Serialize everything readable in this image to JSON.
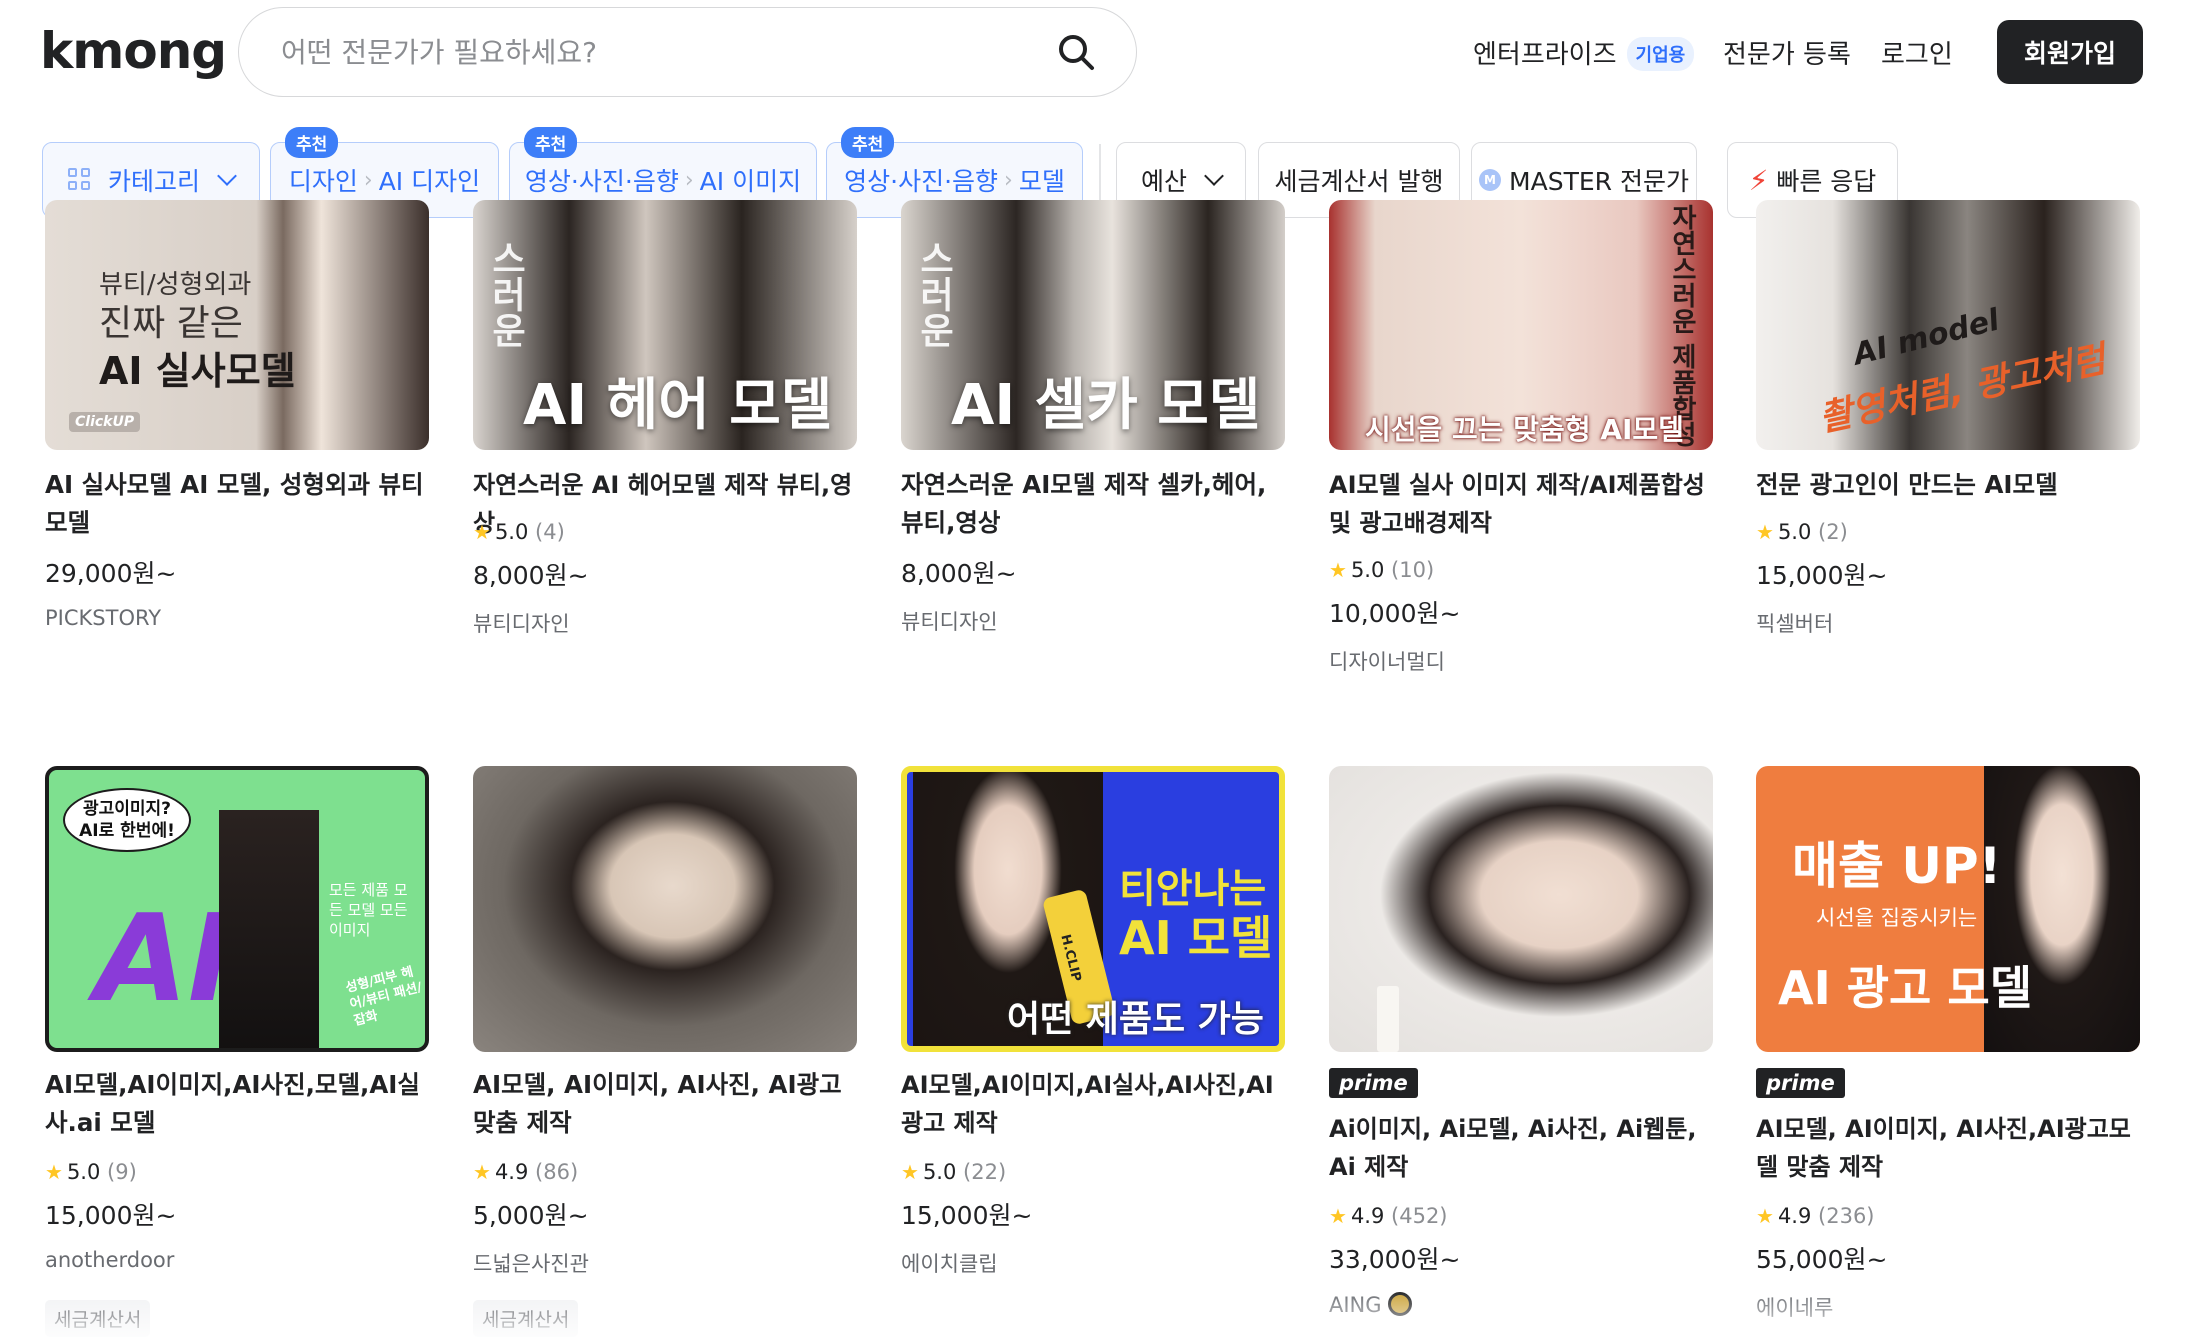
{
  "header": {
    "logo": "kmong",
    "search_placeholder": "어떤 전문가가 필요하세요?",
    "nav": {
      "enterprise": "엔터프라이즈",
      "enterprise_badge": "기업용",
      "register": "전문가 등록",
      "login": "로그인",
      "signup": "회원가입"
    }
  },
  "filters": {
    "category": "카테고리",
    "rec_label": "추천",
    "rec1": {
      "a": "디자인",
      "b": "AI 디자인"
    },
    "rec2": {
      "a": "영상·사진·음향",
      "b": "AI 이미지"
    },
    "rec3": {
      "a": "영상·사진·음향",
      "b": "모델"
    },
    "budget": "예산",
    "tax": "세금계산서 발행",
    "master": "MASTER 전문가",
    "fast": "빠른 응답"
  },
  "row1": [
    {
      "title": "AI 실사모델 AI 모델, 성형외과 뷰티 모델",
      "price": "29,000원~",
      "seller": "PICKSTORY",
      "overlay1": "뷰티/성형외과",
      "overlay2": "진짜 같은",
      "overlay3": "AI 실사모델",
      "watermark": "ClickUP"
    },
    {
      "title": "자연스러운 AI 헤어모델 제작 뷰티,영상",
      "rating": "5.0",
      "count": "(4)",
      "price": "8,000원~",
      "seller": "뷰티디자인",
      "overlay1": "AI 헤어 모델",
      "side": "스러운"
    },
    {
      "title": "자연스러운 AI모델 제작 셀카,헤어,뷰티,영상",
      "price": "8,000원~",
      "seller": "뷰티디자인",
      "overlay1": "AI 셀카 모델",
      "side": "스러운"
    },
    {
      "title": "AI모델 실사 이미지 제작/AI제품합성 및 광고배경제작",
      "rating": "5.0",
      "count": "(10)",
      "price": "10,000원~",
      "seller": "디자이너멀디",
      "overlay1": "시선을 끄는 맞춤형 AI모델",
      "side": "자연스러운 제품합성"
    },
    {
      "title": "전문 광고인이 만드는 AI모델",
      "rating": "5.0",
      "count": "(2)",
      "price": "15,000원~",
      "seller": "픽셀버터",
      "overlay1": "AI model",
      "overlay2": "촬영처럼, 광고처럼"
    }
  ],
  "row2": [
    {
      "title": "AI모델,AI이미지,AI사진,모델,AI실사.ai 모델",
      "rating": "5.0",
      "count": "(9)",
      "price": "15,000원~",
      "seller": "anotherdoor",
      "tag": "세금계산서",
      "bubble": "광고이미지? AI로 한번에!",
      "big": "AI",
      "side": "모든 제품 모든 모델 모든 이미지",
      "small": "성형/피부 헤어/뷰티 패션/잡화"
    },
    {
      "title": "AI모델, AI이미지, AI사진, AI광고 맞춤 제작",
      "rating": "4.9",
      "count": "(86)",
      "price": "5,000원~",
      "seller": "드넓은사진관",
      "tag": "세금계산서"
    },
    {
      "title": "AI모델,AI이미지,AI실사,AI사진,AI광고 제작",
      "rating": "5.0",
      "count": "(22)",
      "price": "15,000원~",
      "seller": "에이치클립",
      "overlay1": "티안나는",
      "overlay2": "AI 모델",
      "overlay3": "어떤 제품도 가능",
      "product": "H.CLIP"
    },
    {
      "title": "Ai이미지, Ai모델, Ai사진, Ai웹툰, Ai 제작",
      "rating": "4.9",
      "count": "(452)",
      "price": "33,000원~",
      "seller": "AING",
      "prime": "prime"
    },
    {
      "title": "AI모델, AI이미지, AI사진,AI광고모델 맞춤 제작",
      "rating": "4.9",
      "count": "(236)",
      "price": "55,000원~",
      "seller": "에이네루",
      "prime": "prime",
      "overlay1": "매출 UP!",
      "overlay2": "시선을 집중시키는",
      "overlay3": "AI 광고 모델"
    }
  ],
  "colors": {
    "brand_dark": "#212224",
    "accent_blue": "#2f6ffb",
    "star": "#ffc624"
  }
}
